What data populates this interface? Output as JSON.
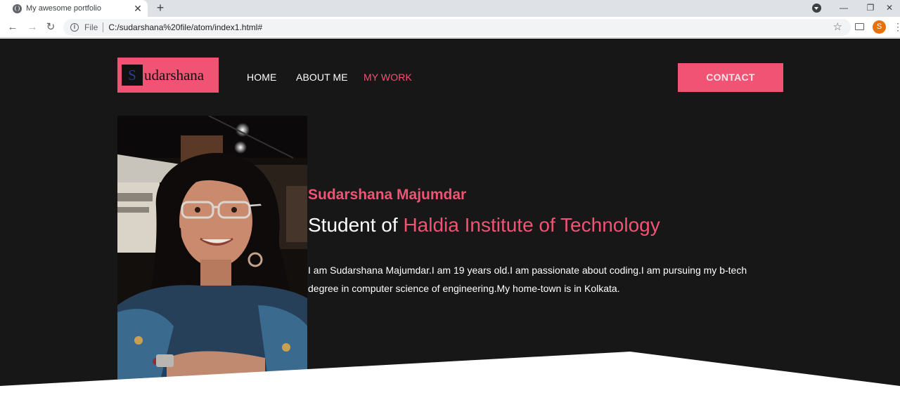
{
  "browser": {
    "tab_title": "My awesome portfolio",
    "tab_close": "✕",
    "new_tab": "+",
    "scheme_label": "File",
    "url": "C:/sudarshana%20file/atom/index1.html#",
    "profile_initial": "S",
    "icons": [
      "globe-icon",
      "back-arrow-icon",
      "forward-arrow-icon",
      "reload-icon",
      "info-icon",
      "star-icon",
      "cast-icon",
      "avatar",
      "menu-dots-icon",
      "minimize-icon",
      "restore-icon",
      "close-icon"
    ]
  },
  "site": {
    "logo_letter": "S",
    "logo_text": "udarshana",
    "nav": [
      {
        "label": "HOME"
      },
      {
        "label": "ABOUT ME"
      },
      {
        "label": "MY WORK"
      }
    ],
    "contact_label": "CONTACT",
    "hero": {
      "name": "Sudarshana Majumdar",
      "subtitle_prefix": "Student of ",
      "subtitle_highlight": "Haldia Institute of Technology",
      "bio": "I am Sudarshana Majumdar.I am 19 years old.I am passionate about coding.I am pursuing my b-tech degree in computer science of engineering.My home-town is in Kolkata."
    },
    "colors": {
      "accent": "#f05373",
      "background": "#171717",
      "text": "#ffffff"
    }
  }
}
